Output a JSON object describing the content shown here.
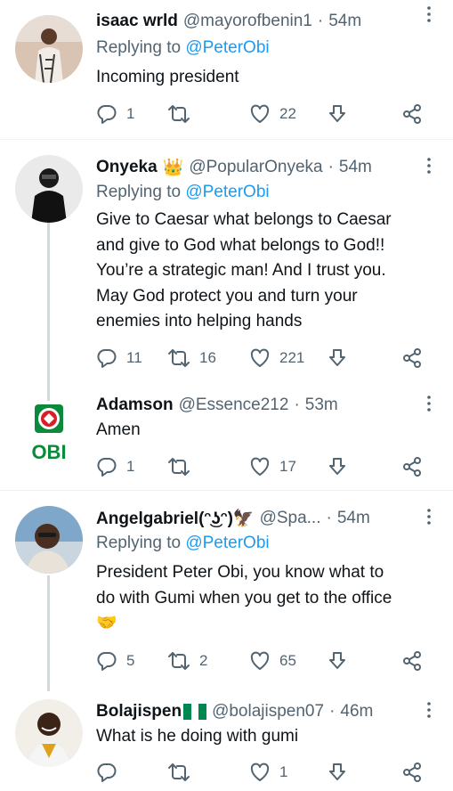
{
  "tweets": [
    {
      "name": "isaac wrld",
      "handle": "@mayorofbenin1",
      "dot": "·",
      "time": "54m",
      "reply_prefix": "Replying to",
      "reply_to": "@PeterObi",
      "text": "Incoming president",
      "stats": {
        "replies": "1",
        "retweets": "",
        "likes": "22"
      }
    },
    {
      "name": "Onyeka",
      "badge": "👑",
      "handle": "@PopularOnyeka",
      "dot": "·",
      "time": "54m",
      "reply_prefix": "Replying to",
      "reply_to": "@PeterObi",
      "text_lines": [
        "Give to Caesar what belongs to Caesar",
        "and give to God what belongs to God!!",
        "You’re a strategic man! And I trust you.",
        "May God protect you and turn your",
        "enemies into helping hands"
      ],
      "stats": {
        "replies": "11",
        "retweets": "16",
        "likes": "221"
      }
    },
    {
      "name": "Adamson",
      "handle": "@Essence212",
      "dot": "·",
      "time": "53m",
      "avatar_text": "OBI",
      "text": "Amen",
      "stats": {
        "replies": "1",
        "retweets": "",
        "likes": "17"
      }
    },
    {
      "name": "Angelgabriel(ᵔ͜ʖᵔ)🦅",
      "handle": "@Spa...",
      "dot": "·",
      "time": "54m",
      "reply_prefix": "Replying to",
      "reply_to": "@PeterObi",
      "text_lines": [
        "President Peter Obi, you know what to",
        "do with Gumi when you get to the office",
        "🤝"
      ],
      "stats": {
        "replies": "5",
        "retweets": "2",
        "likes": "65"
      }
    },
    {
      "name": "Bolajispen",
      "badge": "🇳🇬",
      "handle": "@bolajispen07",
      "dot": "·",
      "time": "46m",
      "text": "What is he doing with gumi",
      "stats": {
        "replies": "",
        "retweets": "",
        "likes": "1"
      }
    }
  ],
  "colors": {
    "text": "#0f1419",
    "secondary": "#536471",
    "link": "#1d9bf0",
    "divider": "#eff3f4",
    "thread_line": "#cfd9de",
    "obi_green": "#0b8a3c",
    "obi_red": "#d81e26"
  },
  "icons": [
    "more-icon",
    "reply-icon",
    "retweet-icon",
    "like-icon",
    "download-icon",
    "share-icon"
  ]
}
